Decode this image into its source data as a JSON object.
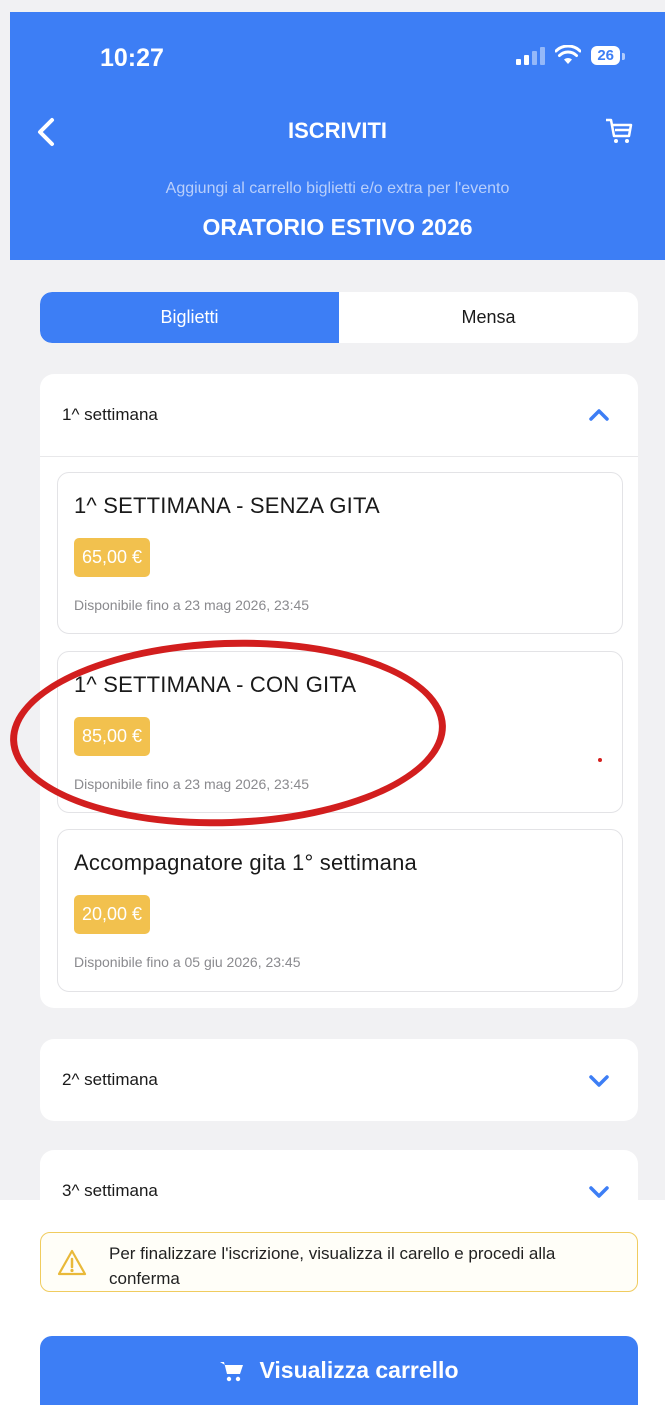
{
  "status_bar": {
    "time": "10:27",
    "battery": "26"
  },
  "header": {
    "title": "ISCRIVITI",
    "subtitle": "Aggiungi al carrello biglietti e/o extra per l'evento",
    "event_title": "ORATORIO ESTIVO 2026"
  },
  "tabs": [
    {
      "label": "Biglietti",
      "active": true
    },
    {
      "label": "Mensa",
      "active": false
    }
  ],
  "sections": [
    {
      "label": "1^ settimana",
      "expanded": true,
      "tickets": [
        {
          "name": "1^ SETTIMANA - SENZA GITA",
          "price": "65,00 €",
          "availability": "Disponibile fino a 23 mag 2026, 23:45"
        },
        {
          "name": "1^ SETTIMANA - CON GITA",
          "price": "85,00 €",
          "availability": "Disponibile fino a 23 mag 2026, 23:45"
        },
        {
          "name": "Accompagnatore gita 1° settimana",
          "price": "20,00 €",
          "availability": "Disponibile fino a 05 giu 2026, 23:45"
        }
      ]
    },
    {
      "label": "2^ settimana",
      "expanded": false
    },
    {
      "label": "3^ settimana",
      "expanded": false
    }
  ],
  "notice": {
    "text": "Per finalizzare l'iscrizione, visualizza il carello e procedi alla conferma"
  },
  "cart_button": {
    "label": "Visualizza carrello"
  },
  "colors": {
    "primary": "#3d7ef5",
    "price_badge": "#f2c14e",
    "annotation": "#d21e1e"
  },
  "icons": [
    "back-icon",
    "cart-icon",
    "chevron-up-icon",
    "chevron-down-icon",
    "warning-icon",
    "wifi-icon",
    "signal-icon"
  ]
}
